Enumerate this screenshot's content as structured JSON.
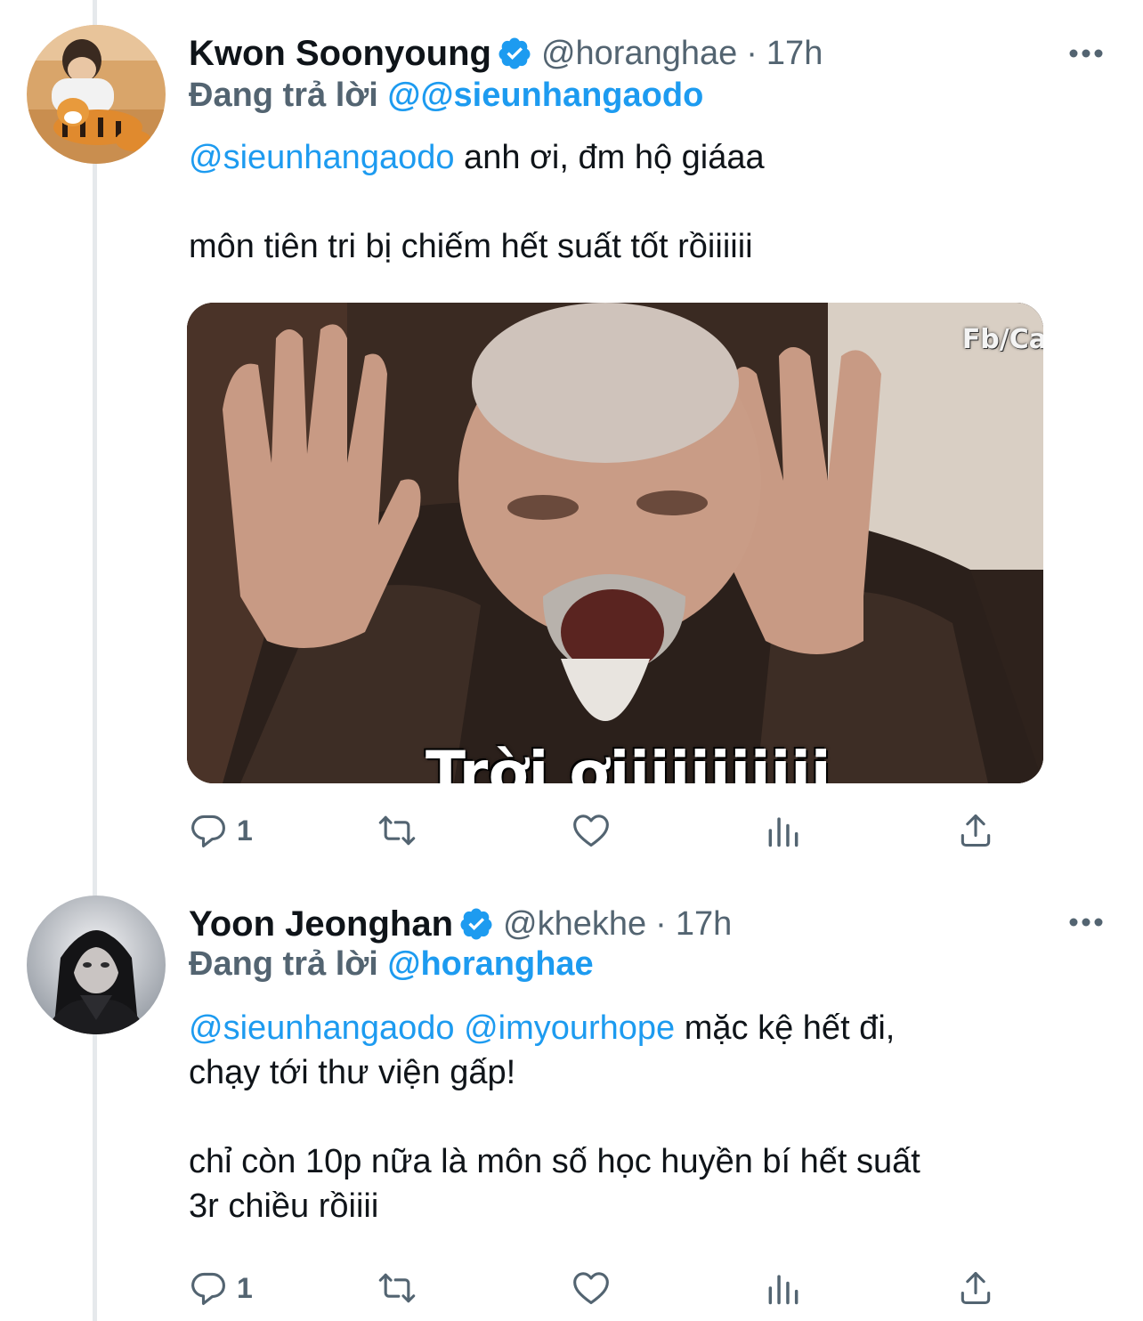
{
  "colors": {
    "accent": "#1d9bf0",
    "text_primary": "#0f1419",
    "text_secondary": "#536471",
    "thread_line": "#e6e9ec"
  },
  "tweets": [
    {
      "author": {
        "name": "Kwon Soonyoung",
        "handle": "@horanghae",
        "verified_icon": "verified-badge-icon",
        "avatar": "avatar-person-with-tiger-plush"
      },
      "separator": "·",
      "time": "17h",
      "reply_to": {
        "prefix": "Đang trả lời ",
        "user": "@@sieunhangaodo"
      },
      "body": {
        "mention": "@sieunhangaodo",
        "line1": " anh ơi, đm hộ giáaa",
        "line2": "môn tiên tri bị chiếm hết suất tốt rồiiiiii"
      },
      "media": {
        "caption": "Trời ơiiiiiiiiiii",
        "watermark": "Fb/Ca"
      },
      "actions": {
        "reply_count": "1"
      }
    },
    {
      "author": {
        "name": "Yoon Jeonghan",
        "handle": "@khekhe",
        "verified_icon": "verified-badge-icon",
        "avatar": "avatar-dark-portrait"
      },
      "separator": "·",
      "time": "17h",
      "reply_to": {
        "prefix": "Đang trả lời ",
        "user": "@horanghae"
      },
      "body": {
        "mention1": "@sieunhangaodo",
        "mention2": "@imyourhope",
        "line1_text": " mặc kệ hết đi,",
        "line2": "chạy tới thư viện gấp!",
        "line3": "chỉ còn 10p nữa là môn số học huyền bí hết suất",
        "line4": "3r chiều rồiiii"
      },
      "actions": {
        "reply_count": "1"
      }
    }
  ]
}
